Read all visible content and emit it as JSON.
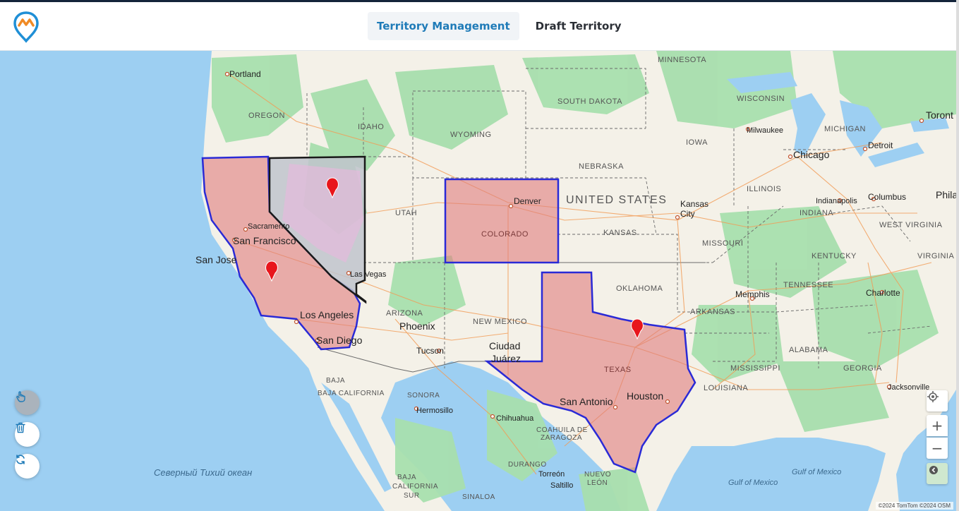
{
  "app": {
    "logo": "route-logo-icon"
  },
  "tabs": [
    {
      "label": "Territory Management",
      "active": true
    },
    {
      "label": "Draft Territory",
      "active": false
    }
  ],
  "map": {
    "country_label": "UNITED STATES",
    "city_labels": {
      "portland": "Portland",
      "sacramento": "Sacramento",
      "san_francisco": "San Francisco",
      "san_jose": "San Jose",
      "los_angeles": "Los Angeles",
      "san_diego": "San Diego",
      "las_vegas": "Las Vegas",
      "phoenix": "Phoenix",
      "tucson": "Tucson",
      "ciudad_juarez_1": "Ciudad",
      "ciudad_juarez_2": "Juárez",
      "denver": "Denver",
      "kansas_city_1": "Kansas",
      "kansas_city_2": "City",
      "chicago": "Chicago",
      "milwaukee": "Milwaukee",
      "detroit": "Detroit",
      "toronto": "Toront",
      "indianapolis": "Indianapolis",
      "columbus": "Columbus",
      "phila": "Phila",
      "memphis": "Memphis",
      "charlotte": "Charlotte",
      "jacksonville": "Jacksonville",
      "houston": "Houston",
      "san_antonio": "San Antonio",
      "hermosillo": "Hermosillo",
      "chihuahua": "Chihuahua",
      "torreon": "Torreón",
      "saltillo": "Saltillo"
    },
    "state_labels": {
      "oregon": "OREGON",
      "idaho": "IDAHO",
      "wyoming": "WYOMING",
      "south_dakota": "SOUTH DAKOTA",
      "minnesota": "MINNESOTA",
      "wisconsin": "WISCONSIN",
      "michigan": "MICHIGAN",
      "iowa": "IOWA",
      "nebraska": "NEBRASKA",
      "illinois": "ILLINOIS",
      "utah": "UTAH",
      "colorado": "COLORADO",
      "kansas": "KANSAS",
      "missouri": "MISSOURI",
      "indiana": "INDIANA",
      "west_virginia": "WEST VIRGINIA",
      "virginia": "VIRGINIA",
      "kentucky": "KENTUCKY",
      "tennessee": "TENNESSEE",
      "oklahoma": "OKLAHOMA",
      "arkansas": "ARKANSAS",
      "arizona": "ARIZONA",
      "new_mexico": "NEW MEXICO",
      "texas": "TEXAS",
      "mississippi": "MISSISSIPPI",
      "alabama": "ALABAMA",
      "georgia": "GEORGIA",
      "louisiana": "LOUISIANA",
      "baja_california": "BAJA CALIFORNIA",
      "baja_california_1": "BAJA",
      "baja_california_2": "CALIFORNIA",
      "baja_california_3": "SUR",
      "sonora": "SONORA",
      "coahuila_1": "COAHUILA DE",
      "coahuila_2": "ZARAGOZA",
      "durango": "DURANGO",
      "sinaloa": "SINALOA",
      "nuevo_leon_1": "NUEVO",
      "nuevo_leon_2": "LEÓN"
    },
    "water_labels": {
      "pacific": "Северный Тихий океан",
      "gulf_1": "Gulf of Mexico",
      "gulf_2": "Gulf of Mexico"
    },
    "attribution": "©2024 TomTom ©2024 OSM",
    "territory_colors": {
      "fill": "#e07d7d",
      "outline_selected": "#1a1a1a",
      "outline": "#2a2ad6",
      "nevada_fill": "#bfc4cc"
    },
    "markers": [
      "california-marker",
      "nevada-marker",
      "texas-marker"
    ]
  },
  "left_controls": [
    {
      "name": "draw-hand-button",
      "icon": "hand-pointer-icon",
      "selected": true
    },
    {
      "name": "delete-button",
      "icon": "trash-icon",
      "selected": false
    },
    {
      "name": "refresh-button",
      "icon": "refresh-icon",
      "selected": false
    }
  ],
  "right_controls": {
    "zoom_in": "+",
    "zoom_out": "−"
  }
}
